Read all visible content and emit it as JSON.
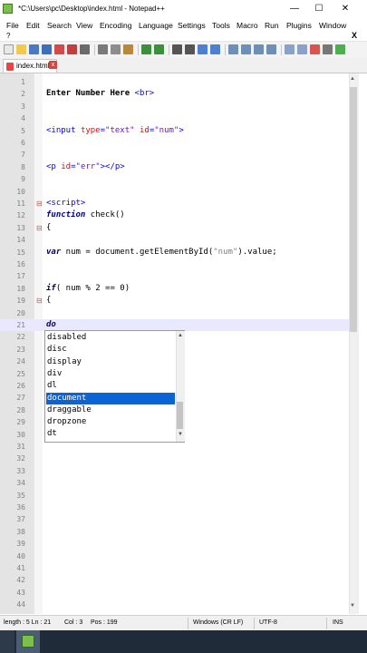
{
  "window": {
    "title": "*C:\\Users\\pc\\Desktop\\index.html - Notepad++",
    "minimize": "—",
    "maximize": "☐",
    "close": "✕"
  },
  "menu": {
    "items": [
      "File",
      "Edit",
      "Search",
      "View",
      "Encoding",
      "Language",
      "Settings",
      "Tools",
      "Macro",
      "Run",
      "Plugins",
      "Window"
    ],
    "help": "?",
    "close_doc": "X"
  },
  "tab": {
    "label": "index.html",
    "close": "x"
  },
  "editor": {
    "lines": [
      {
        "n": "1",
        "text": ""
      },
      {
        "n": "2",
        "text": "Enter Number Here <br>"
      },
      {
        "n": "3",
        "text": ""
      },
      {
        "n": "4",
        "text": ""
      },
      {
        "n": "5",
        "text": "<input type=\"text\" id=\"num\">"
      },
      {
        "n": "6",
        "text": ""
      },
      {
        "n": "7",
        "text": ""
      },
      {
        "n": "8",
        "text": "<p id=\"err\"></p>"
      },
      {
        "n": "9",
        "text": ""
      },
      {
        "n": "10",
        "text": ""
      },
      {
        "n": "11",
        "text": "<script>"
      },
      {
        "n": "12",
        "text": "function check()"
      },
      {
        "n": "13",
        "text": "{"
      },
      {
        "n": "14",
        "text": ""
      },
      {
        "n": "15",
        "text": "var num = document.getElementById(\"num\").value;"
      },
      {
        "n": "16",
        "text": ""
      },
      {
        "n": "17",
        "text": ""
      },
      {
        "n": "18",
        "text": "if( num % 2 == 0)"
      },
      {
        "n": "19",
        "text": "{"
      },
      {
        "n": "20",
        "text": ""
      },
      {
        "n": "21",
        "text": "do"
      },
      {
        "n": "22",
        "text": ""
      },
      {
        "n": "23",
        "text": ""
      },
      {
        "n": "24",
        "text": ""
      },
      {
        "n": "25",
        "text": ""
      },
      {
        "n": "26",
        "text": ""
      },
      {
        "n": "27",
        "text": ""
      },
      {
        "n": "28",
        "text": ""
      },
      {
        "n": "29",
        "text": ""
      },
      {
        "n": "30",
        "text": ""
      },
      {
        "n": "31",
        "text": ""
      },
      {
        "n": "32",
        "text": ""
      },
      {
        "n": "33",
        "text": ""
      },
      {
        "n": "34",
        "text": ""
      },
      {
        "n": "35",
        "text": ""
      },
      {
        "n": "36",
        "text": ""
      },
      {
        "n": "37",
        "text": ""
      },
      {
        "n": "38",
        "text": ""
      },
      {
        "n": "39",
        "text": ""
      },
      {
        "n": "40",
        "text": ""
      },
      {
        "n": "41",
        "text": ""
      },
      {
        "n": "42",
        "text": ""
      },
      {
        "n": "43",
        "text": ""
      },
      {
        "n": "44",
        "text": ""
      }
    ],
    "current_line": 21
  },
  "autocomplete": {
    "items": [
      "disabled",
      "disc",
      "display",
      "div",
      "dl",
      "document",
      "draggable",
      "dropzone",
      "dt"
    ],
    "selected": "document"
  },
  "status": {
    "length": "length : 5 Ln : 21",
    "col": "Col : 3",
    "pos": "Pos : 199",
    "eol": "Windows (CR LF)",
    "encoding": "UTF-8",
    "mode": "INS"
  },
  "colors": {
    "accent": "#0a64d8",
    "current_line": "#e8e8ff",
    "keyword": "#000080",
    "tag": "#0000ff",
    "attribute": "#ff0000",
    "attr_value": "#8000ff"
  }
}
